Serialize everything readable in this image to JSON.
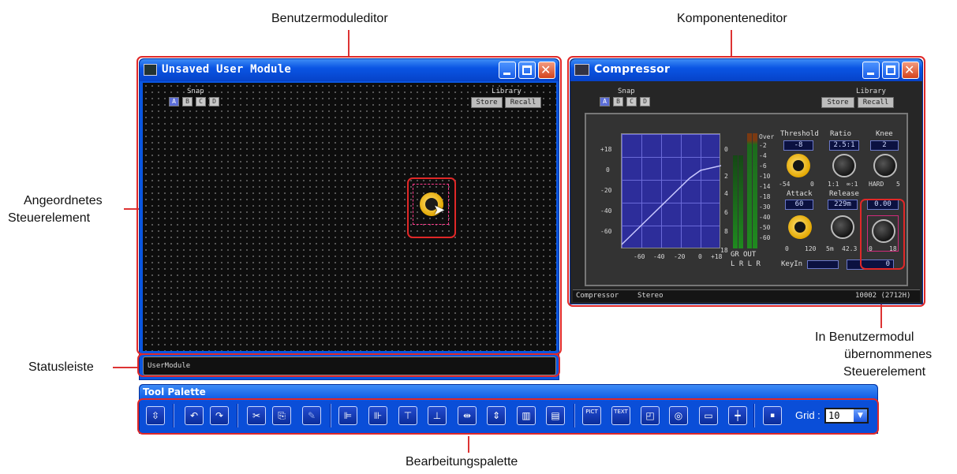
{
  "callouts": {
    "user_module_editor": "Benutzermoduleditor",
    "component_editor": "Komponenteneditor",
    "arranged_control_line1": "Angeordnetes",
    "arranged_control_line2": "Steuerelement",
    "status_bar": "Statusleiste",
    "transferred_line1": "In Benutzermodul",
    "transferred_line2": "übernommenes",
    "transferred_line3": "Steuerelement",
    "edit_palette": "Bearbeitungspalette"
  },
  "user_module_window": {
    "title": "Unsaved User Module",
    "snap_label": "Snap",
    "snap_buttons": [
      "A",
      "B",
      "C",
      "D"
    ],
    "library_label": "Library",
    "store_label": "Store",
    "recall_label": "Recall",
    "status_text": "UserModule"
  },
  "compressor_window": {
    "title": "Compressor",
    "snap_label": "Snap",
    "snap_buttons": [
      "A",
      "B",
      "C",
      "D"
    ],
    "library_label": "Library",
    "store_label": "Store",
    "recall_label": "Recall",
    "graph_y_ticks": [
      "+18",
      "0",
      "-20",
      "-40",
      "-60"
    ],
    "graph_x_ticks": [
      "-60",
      "-40",
      "-20",
      "0",
      "+18"
    ],
    "meter_scale_left": [
      "0",
      "2",
      "4",
      "6",
      "8",
      "18"
    ],
    "meter_scale_right": [
      "Over",
      "-2",
      "-4",
      "-6",
      "-10",
      "-14",
      "-18",
      "-30",
      "-40",
      "-50",
      "-60"
    ],
    "meter_labels": {
      "gr": "GR",
      "out": "OUT",
      "channels": "L R L R"
    },
    "params": {
      "threshold": {
        "label": "Threshold",
        "value": "-8",
        "min": "-54",
        "max": "0"
      },
      "ratio": {
        "label": "Ratio",
        "value": "2.5:1",
        "min": "1:1",
        "max": "∞:1"
      },
      "knee": {
        "label": "Knee",
        "value": "2",
        "min": "HARD",
        "max": "5"
      },
      "attack": {
        "label": "Attack",
        "value": "60",
        "min": "0",
        "max": "120"
      },
      "release": {
        "label": "Release",
        "value": "229m",
        "min": "5m",
        "max": "42.3"
      },
      "gain": {
        "value": "0.00",
        "min": "0",
        "max": "18"
      }
    },
    "keyin_label": "KeyIn",
    "keyin_value": "0",
    "status_left": "Compressor",
    "status_mid": "Stereo",
    "status_right": "10002 (2712H)"
  },
  "tool_palette": {
    "title": "Tool Palette",
    "grid_label": "Grid :",
    "grid_value": "10",
    "tools": [
      {
        "name": "select-tool",
        "glyph": "⇳"
      },
      {
        "name": "undo-tool",
        "glyph": "↶"
      },
      {
        "name": "redo-tool",
        "glyph": "↷"
      },
      {
        "name": "cut-tool",
        "glyph": "✂"
      },
      {
        "name": "copy-tool",
        "glyph": "⎘"
      },
      {
        "name": "paste-tool",
        "glyph": "✎"
      },
      {
        "name": "align-left-tool",
        "glyph": "⊫"
      },
      {
        "name": "align-right-tool",
        "glyph": "⊪"
      },
      {
        "name": "align-top-tool",
        "glyph": "⊤"
      },
      {
        "name": "align-bottom-tool",
        "glyph": "⊥"
      },
      {
        "name": "distribute-h-tool",
        "glyph": "⇹"
      },
      {
        "name": "distribute-v-tool",
        "glyph": "⇕"
      },
      {
        "name": "center-v-tool",
        "glyph": "▥"
      },
      {
        "name": "center-h-tool",
        "glyph": "▤"
      },
      {
        "name": "picture-tool",
        "glyph": "PICT"
      },
      {
        "name": "text-tool",
        "glyph": "TEXT"
      },
      {
        "name": "rectangle-tool",
        "glyph": "◰"
      },
      {
        "name": "ellipse-tool",
        "glyph": "◎"
      },
      {
        "name": "panel-tool",
        "glyph": "▭"
      },
      {
        "name": "line-tool",
        "glyph": "┿"
      },
      {
        "name": "grid-toggle-tool",
        "glyph": "▪"
      }
    ]
  },
  "colors": {
    "callout_red": "#e02828",
    "title_blue": "#0a55e4",
    "knob_gold": "#e3a700",
    "editor_bg": "#0d0d0d"
  }
}
